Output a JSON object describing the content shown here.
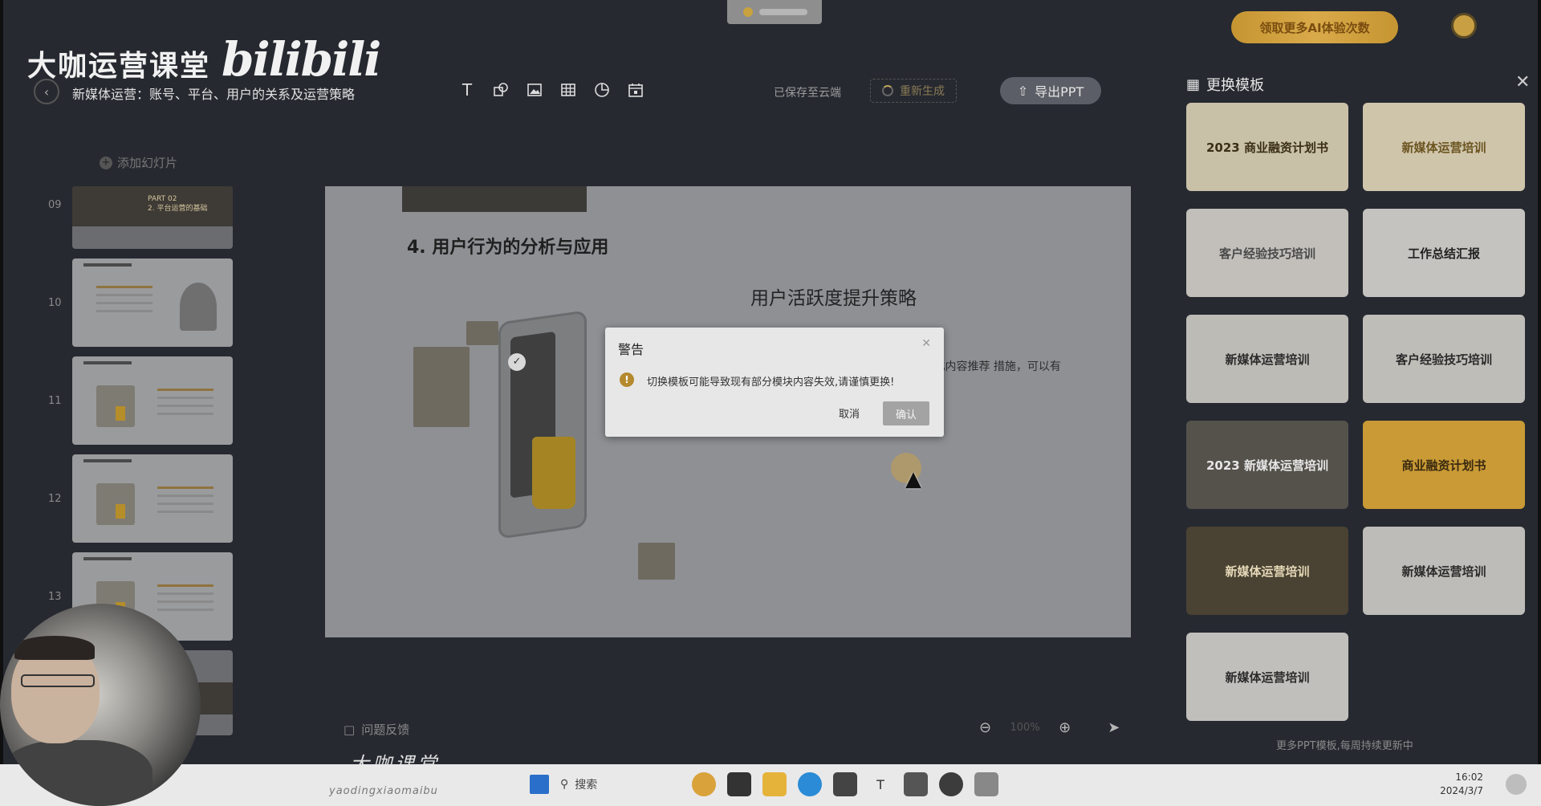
{
  "brand": {
    "name_cn": "大咖运营课堂",
    "logo_text": "bilibili"
  },
  "promo_button": "领取更多AI体验次数",
  "document": {
    "title": "新媒体运营：账号、平台、用户的关系及运营策略",
    "save_status": "已保存至云端",
    "regenerate_label": "重新生成",
    "export_label": "导出PPT"
  },
  "toolbar": {
    "icons": [
      "text-icon",
      "shape-icon",
      "image-icon",
      "table-icon",
      "chart-icon",
      "calendar-icon"
    ]
  },
  "slides_panel": {
    "add_label": "添加幻灯片",
    "numbers": [
      "09",
      "10",
      "11",
      "12",
      "13"
    ],
    "thumb09_lines": [
      "PART 02",
      "2. 平台运营的基础"
    ]
  },
  "main_slide": {
    "heading": "4. 用户行为的分析与应用",
    "subheading": "用户活跃度提升策略",
    "paragraph": "留时长、点赞等数据指 度。例如，优化内容推荐 措施，可以有效吸引用户 参与和持续使用产品。"
  },
  "dialog": {
    "title": "警告",
    "message": "切换模板可能导致现有部分模块内容失效,请谨慎更换!",
    "cancel": "取消",
    "confirm": "确认"
  },
  "bottom": {
    "feedback": "问题反馈",
    "zoom_percent": "100%"
  },
  "template_panel": {
    "title": "更换模板",
    "footer": "更多PPT模板,每周持续更新中",
    "templates": [
      {
        "label": "2023 商业融资计划书",
        "bg": "#c9c0a8",
        "fg": "#3a2e16"
      },
      {
        "label": "新媒体运营培训",
        "bg": "#cfc5ab",
        "fg": "#6b5420"
      },
      {
        "label": "客户经验技巧培训",
        "bg": "#c2bfba",
        "fg": "#4a4a4a"
      },
      {
        "label": "工作总结汇报",
        "bg": "#c4c3c0",
        "fg": "#222222"
      },
      {
        "label": "新媒体运营培训",
        "bg": "#bdbbb6",
        "fg": "#2b2b2b"
      },
      {
        "label": "客户经验技巧培训",
        "bg": "#bfbdb8",
        "fg": "#2b2b2b"
      },
      {
        "label": "2023 新媒体运营培训",
        "bg": "#55524c",
        "fg": "#e6e6e6"
      },
      {
        "label": "商业融资计划书",
        "bg": "#c99a35",
        "fg": "#3a2a10"
      },
      {
        "label": "新媒体运营培训",
        "bg": "#4a4233",
        "fg": "#e6d9b8"
      },
      {
        "label": "新媒体运营培训",
        "bg": "#bdbcb8",
        "fg": "#2b2b2b"
      },
      {
        "label": "新媒体运营培训",
        "bg": "#c0bfbb",
        "fg": "#2b2b2b"
      }
    ]
  },
  "taskbar": {
    "search_label": "搜索",
    "time": "16:02",
    "date": "2024/3/7",
    "handle": "yaodingxiaomaibu"
  },
  "watermark": "大咖课堂"
}
